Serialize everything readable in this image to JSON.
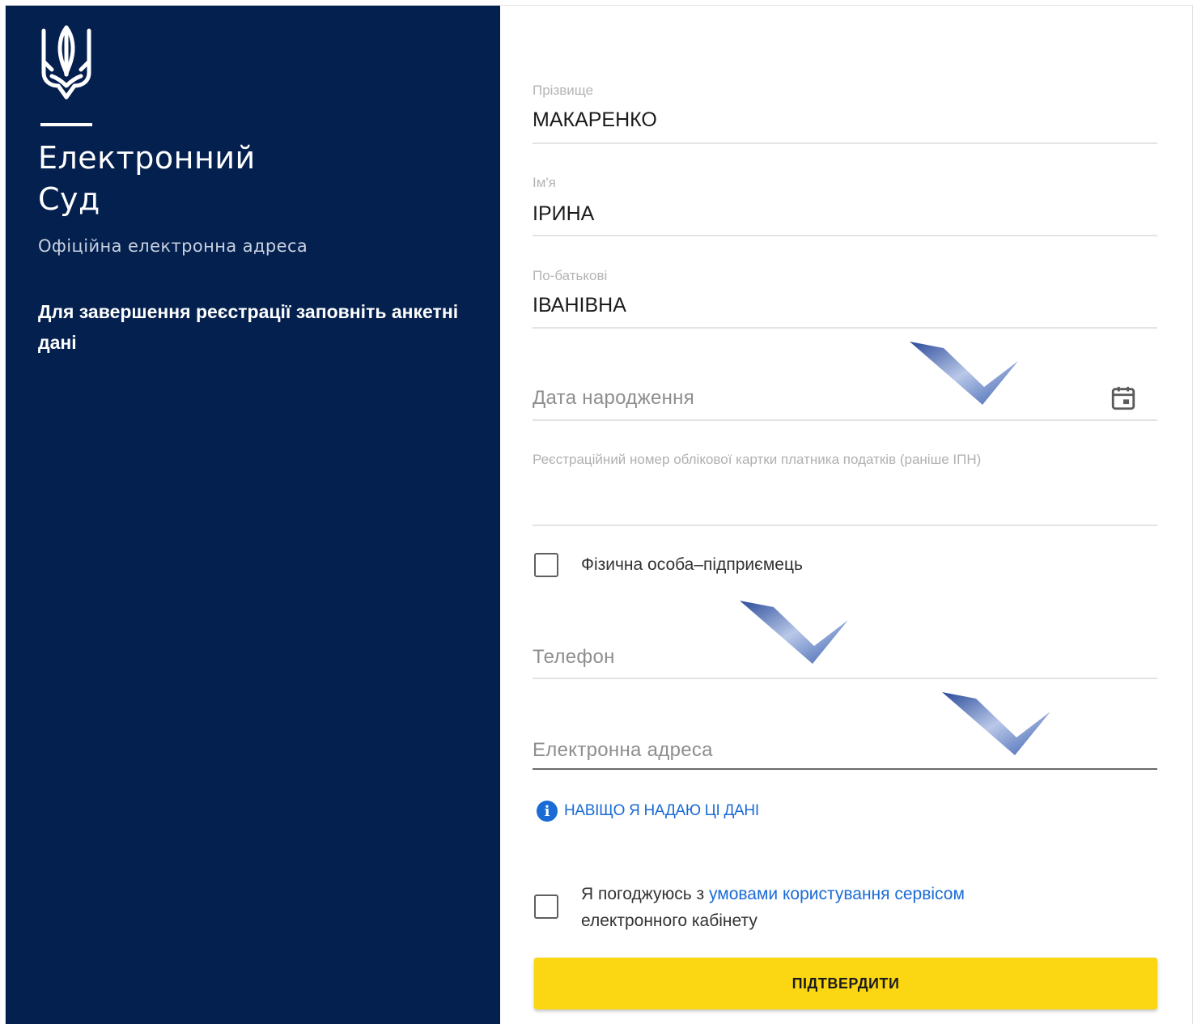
{
  "sidebar": {
    "brand_line1": "Електронний",
    "brand_line2": "Суд",
    "subtitle": "Офіційна електронна адреса",
    "prompt": "Для завершення реєстрації заповніть анкетні дані"
  },
  "form": {
    "surname": {
      "label": "Прізвище",
      "value": "МАКАРЕНКО"
    },
    "first_name": {
      "label": "Ім'я",
      "value": "ІРИНА"
    },
    "patronymic": {
      "label": "По-батькові",
      "value": "ІВАНІВНА"
    },
    "birth_date": {
      "placeholder": "Дата народження",
      "icon": "calendar-icon"
    },
    "tax_number": {
      "label": "Реєстраційний номер облікової картки платника податків (раніше ІПН)",
      "value": ""
    },
    "entrepreneur": {
      "label": "Фізична особа–підприємець",
      "checked": false
    },
    "phone": {
      "placeholder": "Телефон"
    },
    "email": {
      "placeholder": "Електронна адреса"
    },
    "why_link": "НАВІЩО Я НАДАЮ ЦІ ДАНІ",
    "agree": {
      "prefix": "Я погоджуюсь з ",
      "link": "умовами користування сервісом",
      "suffix": "електронного кабінету",
      "checked": false
    },
    "submit_label": "ПІДТВЕРДИТИ"
  },
  "colors": {
    "sidebar_bg": "#04204f",
    "accent_blue": "#1a6bd6",
    "submit_yellow": "#fad712",
    "annotation_check": "#3a5fb0"
  },
  "annotations": [
    {
      "name": "annotation-check-icon",
      "points_to": "birth_date"
    },
    {
      "name": "annotation-check-icon",
      "points_to": "phone"
    },
    {
      "name": "annotation-check-icon",
      "points_to": "email"
    }
  ]
}
